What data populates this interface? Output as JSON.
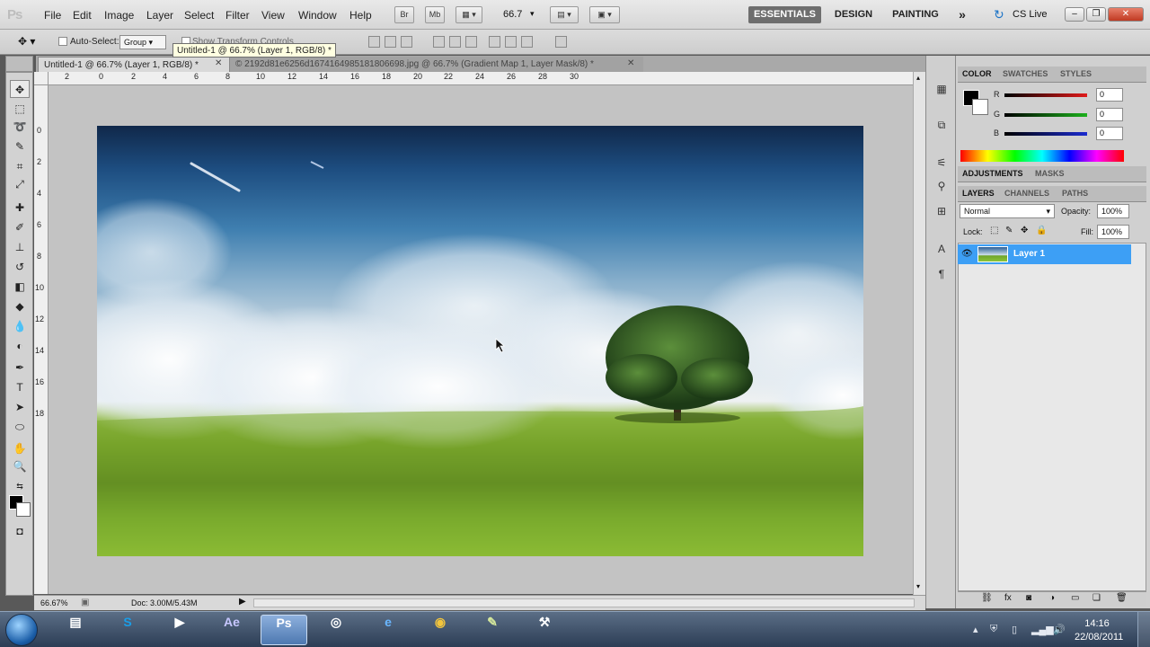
{
  "app": {
    "logo": "Ps"
  },
  "menus": [
    "File",
    "Edit",
    "Image",
    "Layer",
    "Select",
    "Filter",
    "View",
    "Window",
    "Help"
  ],
  "appbar": {
    "bridge": "Br",
    "minibridge": "Mb",
    "zoom": "66.7"
  },
  "workspaces": {
    "essentials": "ESSENTIALS",
    "design": "DESIGN",
    "painting": "PAINTING",
    "more": "»"
  },
  "cslive": "CS Live",
  "window_controls": {
    "minimize": "–",
    "restore": "❐",
    "close": "✕"
  },
  "options": {
    "auto_select_label": "Auto-Select:",
    "auto_select_value": "Group",
    "transform_label": "Show Transform Controls"
  },
  "tabs": [
    {
      "title": "Untitled-1 @ 66.7% (Layer 1, RGB/8) *",
      "close": "✕"
    },
    {
      "title": "© 2192d81e6256d167416498518180669​8.jpg @ 66.7% (Gradient Map 1, Layer Mask/8) *",
      "close": "✕"
    }
  ],
  "tooltip": "Untitled-1 @ 66.7% (Layer 1, RGB/8) *",
  "ruler_h": [
    "2",
    "0",
    "2",
    "4",
    "6",
    "8",
    "10",
    "12",
    "14",
    "16",
    "18",
    "20",
    "22",
    "24",
    "26",
    "28",
    "30"
  ],
  "ruler_v": [
    "0",
    "2",
    "4",
    "6",
    "8",
    "10",
    "12",
    "14",
    "16",
    "18"
  ],
  "status": {
    "zoom": "66.67%",
    "doc": "Doc: 3.00M/5.43M"
  },
  "color_panel": {
    "tabs": [
      "COLOR",
      "SWATCHES",
      "STYLES"
    ],
    "channels": [
      {
        "label": "R",
        "value": "0",
        "color": "#e01a1a"
      },
      {
        "label": "G",
        "value": "0",
        "color": "#1bb01b"
      },
      {
        "label": "B",
        "value": "0",
        "color": "#1b2bd0"
      }
    ]
  },
  "adjustments_panel": {
    "tabs": [
      "ADJUSTMENTS",
      "MASKS"
    ]
  },
  "layers_panel": {
    "tabs": [
      "LAYERS",
      "CHANNELS",
      "PATHS"
    ],
    "blend_mode": "Normal",
    "opacity_label": "Opacity:",
    "opacity": "100%",
    "lock_label": "Lock:",
    "fill_label": "Fill:",
    "fill": "100%",
    "layers": [
      {
        "name": "Layer 1",
        "selected": true
      }
    ]
  },
  "taskbar": {
    "apps": [
      {
        "icon": "folder-icon",
        "label": "▤"
      },
      {
        "icon": "skype-icon",
        "label": "S"
      },
      {
        "icon": "media-icon",
        "label": "▶"
      },
      {
        "icon": "after-effects-icon",
        "label": "Ae"
      },
      {
        "icon": "photoshop-icon",
        "label": "Ps"
      },
      {
        "icon": "camtasia-icon",
        "label": "◎"
      },
      {
        "icon": "browser-icon",
        "label": "e"
      },
      {
        "icon": "chrome-icon",
        "label": "◉"
      },
      {
        "icon": "notes-icon",
        "label": "✎"
      },
      {
        "icon": "tools-icon",
        "label": "⚒"
      }
    ],
    "time": "14:16",
    "date": "22/08/2011"
  }
}
